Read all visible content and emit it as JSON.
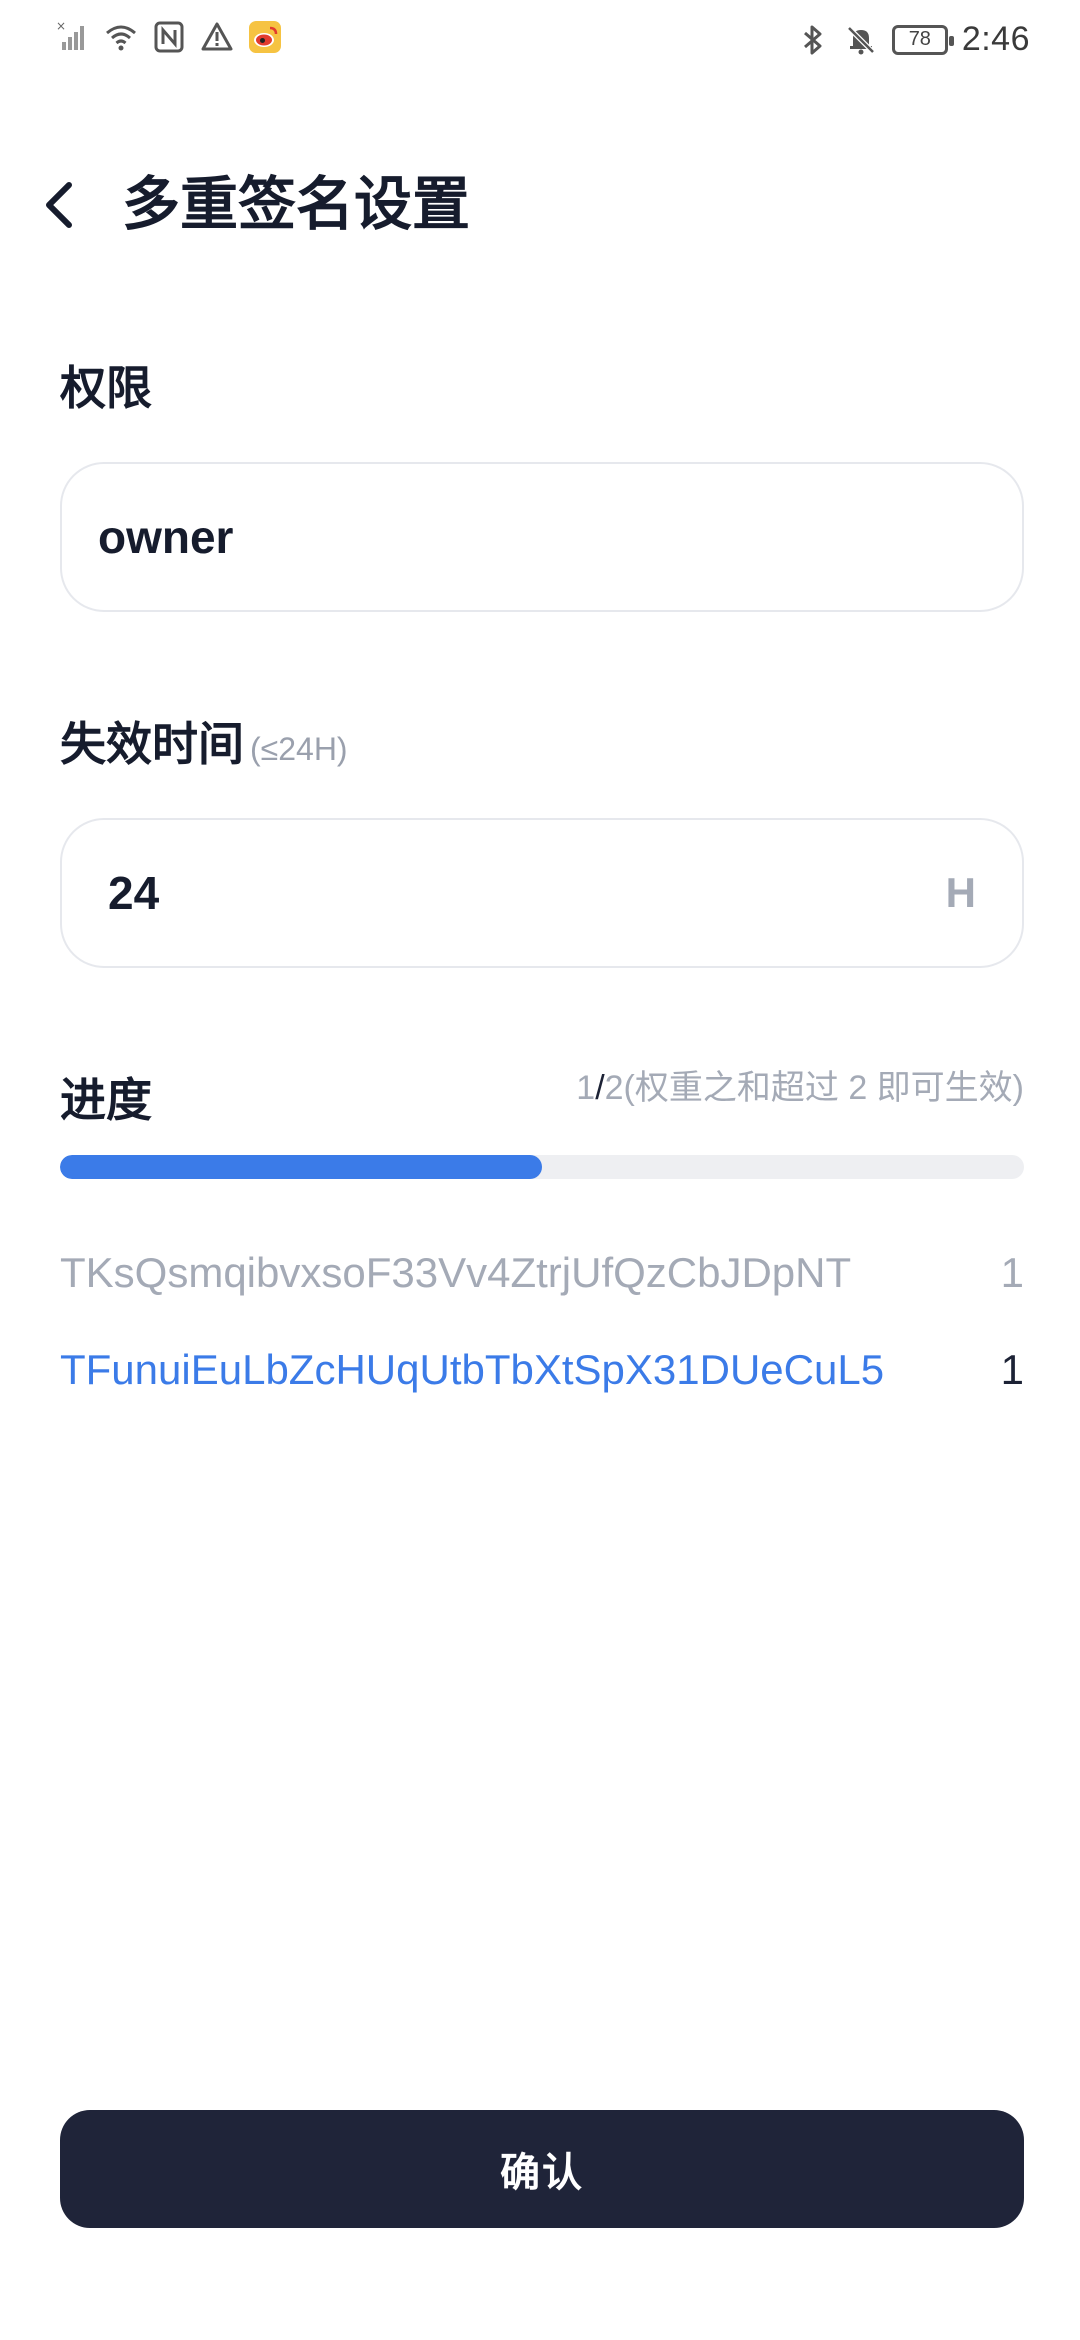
{
  "status_bar": {
    "time": "2:46",
    "battery": "78",
    "left_icons": [
      "signal-off-icon",
      "wifi-icon",
      "nfc-icon",
      "warning-icon",
      "weibo-icon"
    ],
    "right_icons": [
      "bluetooth-icon",
      "bell-muted-icon",
      "battery-icon"
    ]
  },
  "header": {
    "title": "多重签名设置"
  },
  "permission": {
    "label": "权限",
    "value": "owner"
  },
  "expiry": {
    "label": "失效时间",
    "hint": "(≤24H)",
    "value": "24",
    "unit": "H"
  },
  "progress": {
    "label": "进度",
    "current": "1",
    "separator": "/",
    "rest": "2(权重之和超过 2 即可生效)",
    "fraction": 0.5
  },
  "signers": [
    {
      "address": "TKsQsmqibvxsoF33Vv4ZtrjUfQzCbJDpNT",
      "weight": "1"
    },
    {
      "address": "TFunuiEuLbZcHUqUtbTbXtSpX31DUeCuL5",
      "weight": "1"
    }
  ],
  "confirm_label": "确认"
}
